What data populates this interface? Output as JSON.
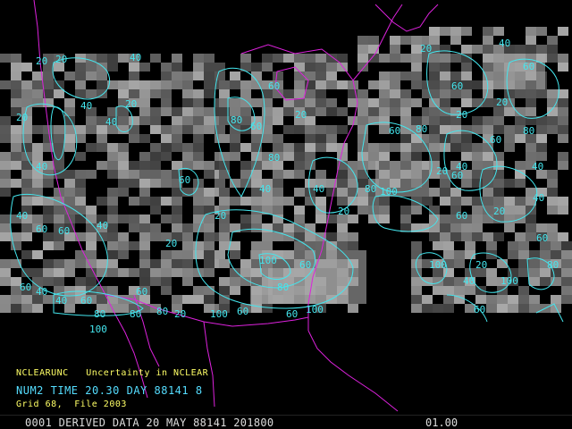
{
  "product": {
    "name": "NCLEARUNC",
    "description": "Uncertainty in NCLEAR",
    "time_line": "NUM2 TIME 20.30 DAY 88141 8",
    "grid_line": "Grid 68,  File 2003"
  },
  "status_bar": {
    "left": "0001 DERIVED DATA 20 MAY 88141 201800",
    "right": "01.00"
  },
  "colors": {
    "background": "#000000",
    "contour": "#44e6ee",
    "boundaries": "#dd22dd",
    "caption": "#ffff66"
  },
  "contour_labels": [
    "20",
    "40",
    "60",
    "80",
    "100"
  ],
  "map_labels": [
    {
      "text": "20"
    },
    {
      "text": "40"
    },
    {
      "text": "40"
    },
    {
      "text": "20"
    },
    {
      "text": "20"
    },
    {
      "text": "40"
    },
    {
      "text": "40"
    },
    {
      "text": "60"
    },
    {
      "text": "80"
    },
    {
      "text": "60"
    },
    {
      "text": "20"
    },
    {
      "text": "40"
    },
    {
      "text": "60"
    },
    {
      "text": "60"
    },
    {
      "text": "40"
    },
    {
      "text": "20"
    },
    {
      "text": "60"
    },
    {
      "text": "40"
    },
    {
      "text": "80"
    },
    {
      "text": "60"
    },
    {
      "text": "100"
    },
    {
      "text": "80"
    },
    {
      "text": "60"
    },
    {
      "text": "20"
    },
    {
      "text": "80"
    },
    {
      "text": "40"
    },
    {
      "text": "60"
    },
    {
      "text": "20"
    },
    {
      "text": "60"
    },
    {
      "text": "80"
    },
    {
      "text": "100"
    },
    {
      "text": "60"
    },
    {
      "text": "20"
    },
    {
      "text": "40"
    },
    {
      "text": "80"
    },
    {
      "text": "60"
    },
    {
      "text": "20"
    },
    {
      "text": "40"
    },
    {
      "text": "60"
    },
    {
      "text": "40"
    },
    {
      "text": "20"
    },
    {
      "text": "60"
    },
    {
      "text": "60"
    },
    {
      "text": "100"
    },
    {
      "text": "80"
    },
    {
      "text": "60"
    },
    {
      "text": "20"
    },
    {
      "text": "40"
    },
    {
      "text": "80"
    },
    {
      "text": "100"
    },
    {
      "text": "100"
    },
    {
      "text": "80"
    },
    {
      "text": "100"
    },
    {
      "text": "60"
    },
    {
      "text": "20"
    },
    {
      "text": "60"
    },
    {
      "text": "40"
    },
    {
      "text": "20"
    },
    {
      "text": "40"
    },
    {
      "text": "20"
    },
    {
      "text": "100"
    },
    {
      "text": "80"
    },
    {
      "text": "60"
    },
    {
      "text": "60"
    },
    {
      "text": "40"
    },
    {
      "text": "20"
    }
  ]
}
